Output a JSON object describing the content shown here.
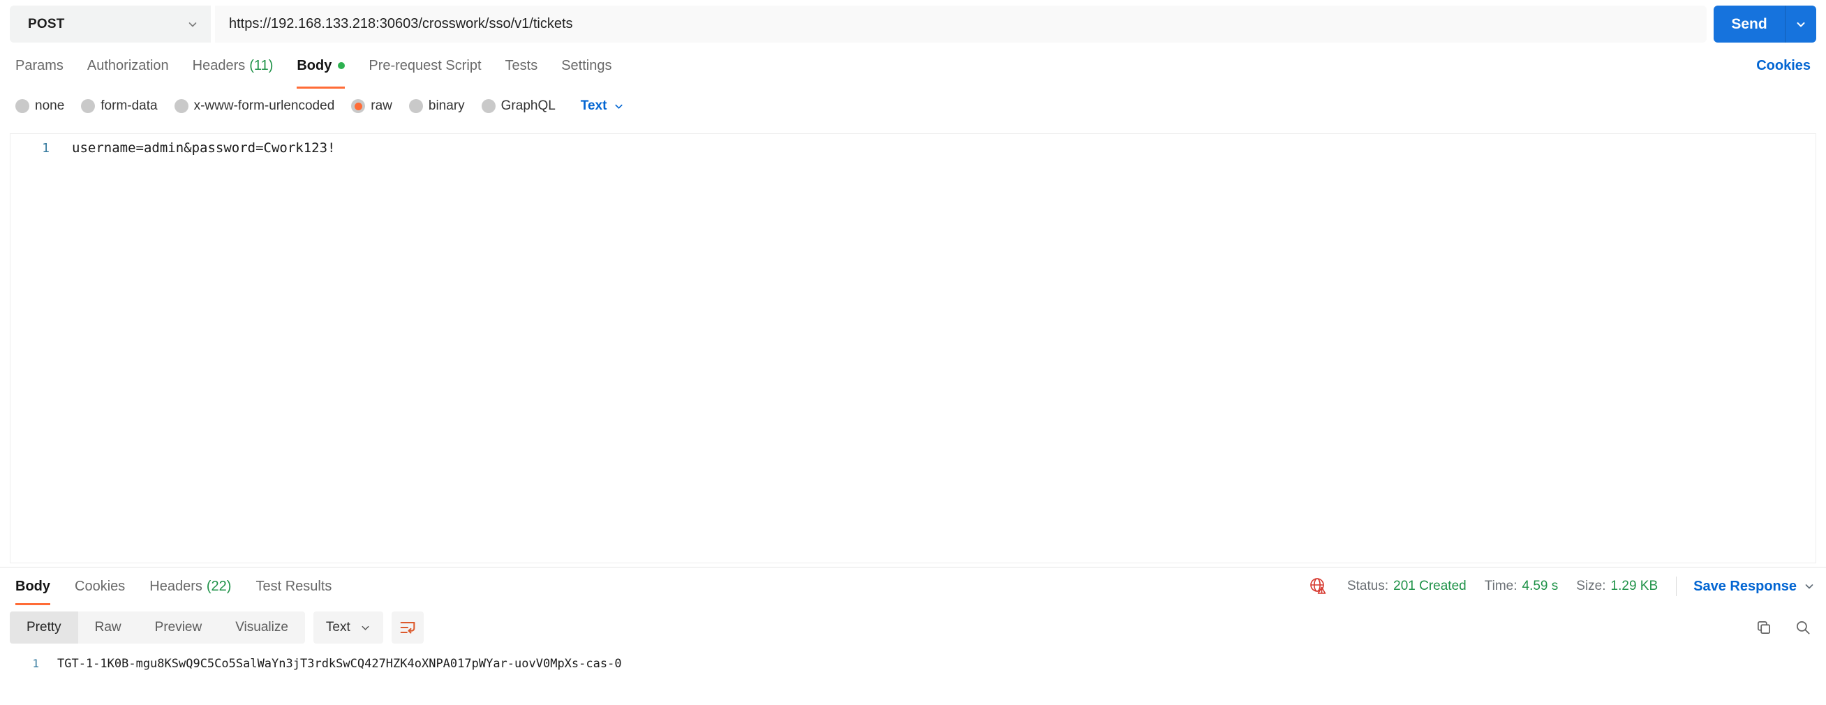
{
  "request_bar": {
    "method": "POST",
    "url": "https://192.168.133.218:30603/crosswork/sso/v1/tickets",
    "send_label": "Send"
  },
  "request_tabs": {
    "items": [
      {
        "label": "Params"
      },
      {
        "label": "Authorization"
      },
      {
        "label": "Headers",
        "count": "(11)"
      },
      {
        "label": "Body"
      },
      {
        "label": "Pre-request Script"
      },
      {
        "label": "Tests"
      },
      {
        "label": "Settings"
      }
    ],
    "active_tab": "Body",
    "cookies_link": "Cookies"
  },
  "body_type_bar": {
    "options": [
      {
        "label": "none"
      },
      {
        "label": "form-data"
      },
      {
        "label": "x-www-form-urlencoded"
      },
      {
        "label": "raw"
      },
      {
        "label": "binary"
      },
      {
        "label": "GraphQL"
      }
    ],
    "selected_option": "raw",
    "language_selector": "Text"
  },
  "request_editor": {
    "line_number": "1",
    "content": "username=admin&password=Cwork123!"
  },
  "response": {
    "tabs": [
      {
        "label": "Body"
      },
      {
        "label": "Cookies"
      },
      {
        "label": "Headers",
        "count": "(22)"
      },
      {
        "label": "Test Results"
      }
    ],
    "active_tab": "Body",
    "meta": {
      "status_label": "Status:",
      "status_value": "201 Created",
      "time_label": "Time:",
      "time_value": "4.59 s",
      "size_label": "Size:",
      "size_value": "1.29 KB",
      "save_label": "Save Response"
    },
    "toolbar": {
      "views": [
        "Pretty",
        "Raw",
        "Preview",
        "Visualize"
      ],
      "active_view": "Pretty",
      "format_selector": "Text"
    },
    "body": {
      "line_number": "1",
      "content": "TGT-1-1K0B-mgu8KSwQ9C5Co5SalWaYn3jT3rdkSwCQ427HZK4oXNPA017pWYar-uovV0MpXs-cas-0"
    }
  },
  "icons": {
    "method_dropdown": "chevron-down-icon",
    "send_dropdown": "chevron-down-icon",
    "ssl_warning": "globe-warning-icon",
    "wrap_lines": "wrap-text-icon",
    "copy": "copy-icon",
    "search": "search-icon"
  },
  "colors": {
    "accent_orange": "#ff6c37",
    "send_blue": "#1673dd",
    "link_blue": "#0265d2",
    "success_green": "#1f9248",
    "error_red": "#d6362c",
    "line_number_teal": "#357a9e"
  }
}
